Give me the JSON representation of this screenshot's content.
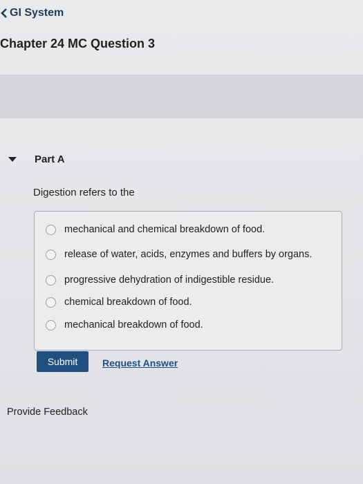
{
  "nav": {
    "back_label": "GI System",
    "back_icon": "chevron-left-icon"
  },
  "title": "Chapter 24 MC Question 3",
  "part": {
    "label": "Part A",
    "toggle_icon": "caret-down-icon"
  },
  "question": {
    "prompt": "Digestion refers to the",
    "options": [
      "mechanical and chemical breakdown of food.",
      "release of water, acids, enzymes and buffers by organs.",
      "progressive dehydration of indigestible residue.",
      "chemical breakdown of food.",
      "mechanical breakdown of food."
    ]
  },
  "actions": {
    "submit_label": "Submit",
    "request_answer_label": "Request Answer"
  },
  "footer": {
    "feedback_label": "Provide Feedback"
  },
  "colors": {
    "accent": "#1f4f7e",
    "link": "#1e4f85",
    "nav_text": "#1e3c5a"
  }
}
